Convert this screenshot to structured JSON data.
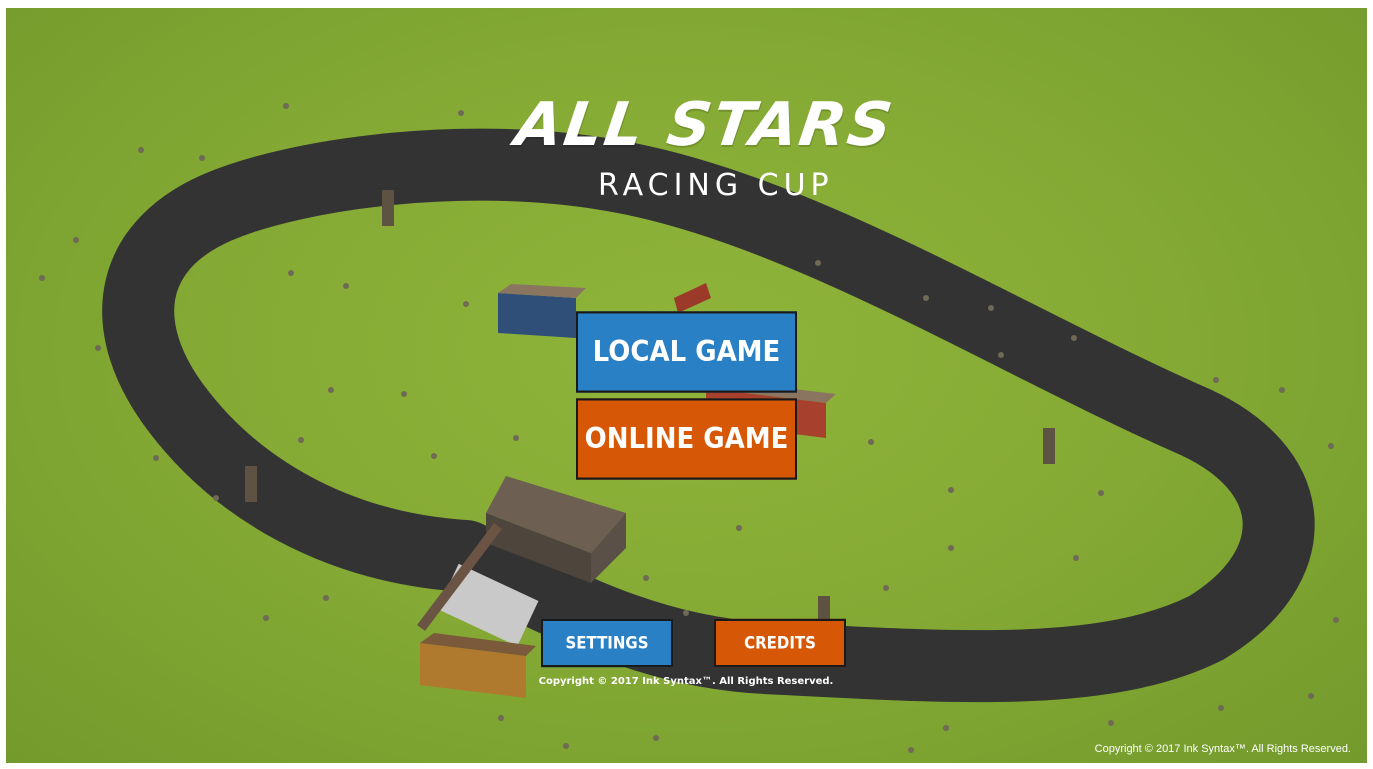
{
  "title": {
    "main": "ALL STARS",
    "sub": "RACING CUP"
  },
  "menu": {
    "local_game": "LOCAL GAME",
    "online_game": "ONLINE GAME",
    "settings": "SETTINGS",
    "credits": "CREDITS"
  },
  "footer": {
    "copyright_center": "Copyright © 2017 Ink Syntax™. All Rights Reserved.",
    "copyright_corner": "Copyright © 2017 Ink Syntax™. All Rights Reserved."
  },
  "colors": {
    "grass": "#86ab35",
    "track": "#333333",
    "button_blue": "#2a80c4",
    "button_orange": "#d65806"
  }
}
